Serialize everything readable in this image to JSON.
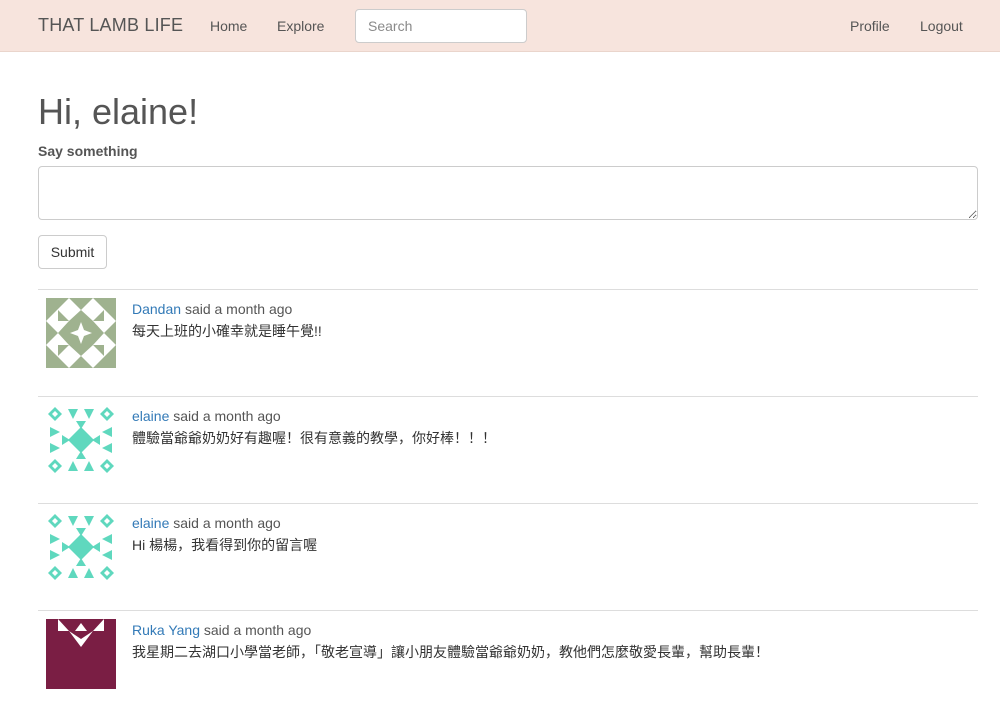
{
  "nav": {
    "brand": "THAT LAMB LIFE",
    "home": "Home",
    "explore": "Explore",
    "search_placeholder": "Search",
    "profile": "Profile",
    "logout": "Logout"
  },
  "greeting": "Hi, elaine!",
  "form": {
    "label": "Say something",
    "submit": "Submit"
  },
  "posts": [
    {
      "user": "Dandan",
      "time": "said a month ago",
      "body": "每天上班的小確幸就是睡午覺!!",
      "avatar_color": "#9fb28f"
    },
    {
      "user": "elaine",
      "time": "said a month ago",
      "body": "體驗當爺爺奶奶好有趣喔！很有意義的教學，你好棒！！！",
      "avatar_color": "#5fd8be"
    },
    {
      "user": "elaine",
      "time": "said a month ago",
      "body": "Hi 楊楊，我看得到你的留言喔",
      "avatar_color": "#5fd8be"
    },
    {
      "user": "Ruka Yang",
      "time": "said a month ago",
      "body": "我星期二去湖口小學當老師，「敬老宣導」讓小朋友體驗當爺爺奶奶，教他們怎麼敬愛長輩，幫助長輩！",
      "avatar_color": "#7a1e44"
    }
  ]
}
